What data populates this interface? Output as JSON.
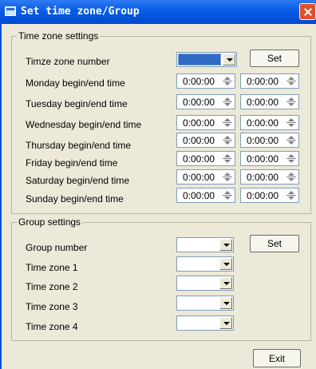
{
  "window": {
    "title": "Set time zone/Group"
  },
  "timezone_settings": {
    "legend": "Time zone settings",
    "number_label": "Timze zone number",
    "set_label": "Set",
    "days": [
      {
        "label": "Monday begin/end time",
        "begin": "0:00:00",
        "end": "0:00:00"
      },
      {
        "label": "Tuesday begin/end time",
        "begin": "0:00:00",
        "end": "0:00:00"
      },
      {
        "label": "Wednesday begin/end time",
        "begin": "0:00:00",
        "end": "0:00:00"
      },
      {
        "label": "Thursday begin/end time",
        "begin": "0:00:00",
        "end": "0:00:00"
      },
      {
        "label": "Friday begin/end time",
        "begin": "0:00:00",
        "end": "0:00:00"
      },
      {
        "label": "Saturday begin/end time",
        "begin": "0:00:00",
        "end": "0:00:00"
      },
      {
        "label": "Sunday begin/end time",
        "begin": "0:00:00",
        "end": "0:00:00"
      }
    ]
  },
  "group_settings": {
    "legend": "Group settings",
    "set_label": "Set",
    "rows": [
      {
        "label": "Group number"
      },
      {
        "label": "Time zone 1"
      },
      {
        "label": "Time zone 2"
      },
      {
        "label": "Time zone 3"
      },
      {
        "label": "Time zone 4"
      }
    ]
  },
  "footer": {
    "exit_label": "Exit"
  },
  "colors": {
    "titlebar": "#0a5fe6",
    "dialog_bg": "#ece9d8",
    "selection": "#316ac5",
    "close": "#e0502a"
  }
}
